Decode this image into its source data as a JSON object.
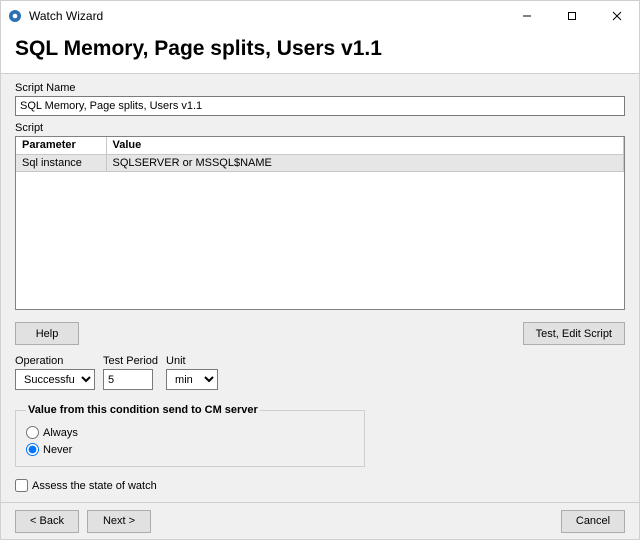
{
  "window": {
    "title": "Watch Wizard"
  },
  "header": {
    "page_title": "SQL Memory, Page splits, Users v1.1"
  },
  "script_name": {
    "label": "Script Name",
    "value": "SQL Memory, Page splits, Users v1.1"
  },
  "script_section": {
    "label": "Script",
    "columns": {
      "param": "Parameter",
      "value": "Value"
    },
    "rows": [
      {
        "param": "Sql instance",
        "value": "SQLSERVER or MSSQL$NAME"
      }
    ]
  },
  "buttons": {
    "help": "Help",
    "test_edit": "Test, Edit Script",
    "back": "< Back",
    "next": "Next >",
    "cancel": "Cancel"
  },
  "operation": {
    "label": "Operation",
    "value": "Successful",
    "options": [
      "Successful"
    ]
  },
  "test_period": {
    "label": "Test Period",
    "value": "5"
  },
  "unit": {
    "label": "Unit",
    "value": "min",
    "options": [
      "min"
    ]
  },
  "send_group": {
    "legend": "Value from this condition send to CM server",
    "always": "Always",
    "never": "Never",
    "selected": "never"
  },
  "assess": {
    "label": "Assess the state of watch",
    "checked": false
  }
}
